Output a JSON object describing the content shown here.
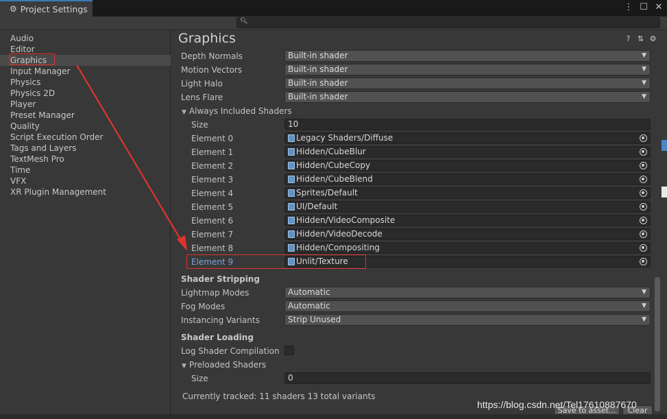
{
  "window": {
    "title": "Project Settings",
    "heading": "Graphics"
  },
  "sidebar": {
    "items": [
      {
        "label": "Audio"
      },
      {
        "label": "Editor"
      },
      {
        "label": "Graphics",
        "selected": true
      },
      {
        "label": "Input Manager"
      },
      {
        "label": "Physics"
      },
      {
        "label": "Physics 2D"
      },
      {
        "label": "Player"
      },
      {
        "label": "Preset Manager"
      },
      {
        "label": "Quality"
      },
      {
        "label": "Script Execution Order"
      },
      {
        "label": "Tags and Layers"
      },
      {
        "label": "TextMesh Pro"
      },
      {
        "label": "Time"
      },
      {
        "label": "VFX"
      },
      {
        "label": "XR Plugin Management"
      }
    ]
  },
  "builtin": {
    "depth_normals": {
      "label": "Depth Normals",
      "value": "Built-in shader"
    },
    "motion_vectors": {
      "label": "Motion Vectors",
      "value": "Built-in shader"
    },
    "light_halo": {
      "label": "Light Halo",
      "value": "Built-in shader"
    },
    "lens_flare": {
      "label": "Lens Flare",
      "value": "Built-in shader"
    }
  },
  "always_included": {
    "label": "Always Included Shaders",
    "size_label": "Size",
    "size": "10",
    "elements": [
      {
        "label": "Element 0",
        "value": "Legacy Shaders/Diffuse"
      },
      {
        "label": "Element 1",
        "value": "Hidden/CubeBlur"
      },
      {
        "label": "Element 2",
        "value": "Hidden/CubeCopy"
      },
      {
        "label": "Element 3",
        "value": "Hidden/CubeBlend"
      },
      {
        "label": "Element 4",
        "value": "Sprites/Default"
      },
      {
        "label": "Element 5",
        "value": "UI/Default"
      },
      {
        "label": "Element 6",
        "value": "Hidden/VideoComposite"
      },
      {
        "label": "Element 7",
        "value": "Hidden/VideoDecode"
      },
      {
        "label": "Element 8",
        "value": "Hidden/Compositing"
      },
      {
        "label": "Element 9",
        "value": "Unlit/Texture"
      }
    ]
  },
  "stripping": {
    "title": "Shader Stripping",
    "lightmap": {
      "label": "Lightmap Modes",
      "value": "Automatic"
    },
    "fog": {
      "label": "Fog Modes",
      "value": "Automatic"
    },
    "instancing": {
      "label": "Instancing Variants",
      "value": "Strip Unused"
    }
  },
  "loading": {
    "title": "Shader Loading",
    "log_label": "Log Shader Compilation",
    "preloaded_label": "Preloaded Shaders",
    "size_label": "Size",
    "size": "0"
  },
  "status": "Currently tracked: 11 shaders 13 total variants",
  "buttons": {
    "save": "Save to asset...",
    "clear": "Clear"
  },
  "watermark": "https://blog.csdn.net/Tel17610887670",
  "colors": {
    "annotation": "#e0332e",
    "selected_element": "#7fa5d6"
  }
}
